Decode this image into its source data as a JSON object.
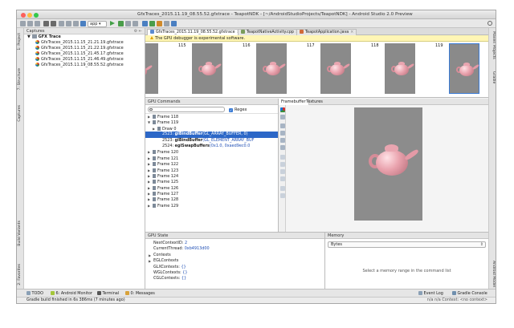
{
  "window": {
    "title": "GfxTraces_2015.11.19_08.55.52.gfxtrace - TeapotNDK - [~/AndroidStudioProjects/TeapotNDK] - Android Studio 2.0 Preview"
  },
  "toolbar": {
    "app_selector": "app"
  },
  "left_strip": {
    "tabs": [
      "1: Project",
      "7: Structure",
      "Captures",
      "Build Variants",
      "2: Favorites"
    ]
  },
  "right_strip": {
    "tabs": [
      "Maven Projects",
      "Gradle",
      "Android Model"
    ]
  },
  "captures": {
    "header": "Captures",
    "root": "GFX Trace",
    "items": [
      "GfxTraces_2015.11.15_21.21.19.gfxtrace",
      "GfxTraces_2015.11.15_21.22.19.gfxtrace",
      "GfxTraces_2015.11.15_21.45.17.gfxtrace",
      "GfxTraces_2015.11.15_21.46.49.gfxtrace",
      "GfxTraces_2015.11.19_08.55.52.gfxtrace"
    ]
  },
  "editor_tabs": [
    {
      "label": "GfxTraces_2015.11.19_08.55.52.gfxtrace",
      "active": true,
      "icon_color": "#5b8bd0"
    },
    {
      "label": "TeapotNativeActivity.cpp",
      "active": false,
      "icon_color": "#7a9c5a"
    },
    {
      "label": "TeapotApplication.java",
      "active": false,
      "icon_color": "#d06a3a"
    }
  ],
  "notice": {
    "text": "The GPU debugger is experimental software."
  },
  "frames": [
    "115",
    "116",
    "117",
    "118",
    "119"
  ],
  "gpu_commands": {
    "header": "GPU Commands",
    "filter_placeholder": "",
    "regex_label": "Regex",
    "rows": [
      {
        "text": "Frame 118",
        "arrow": "▶",
        "level": 0
      },
      {
        "text": "Frame 119",
        "arrow": "▼",
        "level": 0
      },
      {
        "text": "Draw 0",
        "arrow": "▶",
        "level": 1
      },
      {
        "id": "2523:",
        "fn": "glBindBuffer",
        "args": "(GL_ARRAY_BUFFER, 0)",
        "level": 2,
        "selected": true
      },
      {
        "id": "2523:",
        "fn": "glBindBuffer",
        "args": "(GL_ELEMENT_ARRAY_BUF",
        "level": 2
      },
      {
        "id": "2524:",
        "fn": "eglSwapBuffers",
        "args": "(0x1.0, 0xaed9ec0.0",
        "level": 2
      },
      {
        "text": "Frame 120",
        "arrow": "▶",
        "level": 0
      },
      {
        "text": "Frame 121",
        "arrow": "▶",
        "level": 0
      },
      {
        "text": "Frame 122",
        "arrow": "▶",
        "level": 0
      },
      {
        "text": "Frame 123",
        "arrow": "▶",
        "level": 0
      },
      {
        "text": "Frame 124",
        "arrow": "▶",
        "level": 0
      },
      {
        "text": "Frame 125",
        "arrow": "▶",
        "level": 0
      },
      {
        "text": "Frame 126",
        "arrow": "▶",
        "level": 0
      },
      {
        "text": "Frame 127",
        "arrow": "▶",
        "level": 0
      },
      {
        "text": "Frame 128",
        "arrow": "▶",
        "level": 0
      },
      {
        "text": "Frame 129",
        "arrow": "▶",
        "level": 0
      }
    ]
  },
  "framebuffer": {
    "tabs": [
      "Framebuffer",
      "Textures"
    ]
  },
  "gpu_state": {
    "header": "GPU State",
    "rows": [
      {
        "key": "NextContextID:",
        "val": "2"
      },
      {
        "key": "CurrentThread:",
        "val": "0xb4913d00"
      },
      {
        "key": "Contexts",
        "val": "",
        "arrow": "▶"
      },
      {
        "key": "EGLContexts",
        "val": "",
        "arrow": "▶"
      },
      {
        "key": "GLXContexts:",
        "val": "{}"
      },
      {
        "key": "WGLContexts:",
        "val": "{}"
      },
      {
        "key": "CGLContexts:",
        "val": "{}"
      }
    ]
  },
  "memory": {
    "header": "Memory",
    "select_value": "Bytes",
    "message": "Select a memory range in the command list"
  },
  "bottom_tabs": {
    "todo": "TODO",
    "android_monitor": "6: Android Monitor",
    "terminal": "Terminal",
    "messages": "0: Messages",
    "event_log": "Event Log",
    "gradle_console": "Gradle Console"
  },
  "status": {
    "message": "Gradle build finished in 6s 386ms (7 minutes ago)",
    "right": "n/a     n/a     Context: <no context>"
  }
}
